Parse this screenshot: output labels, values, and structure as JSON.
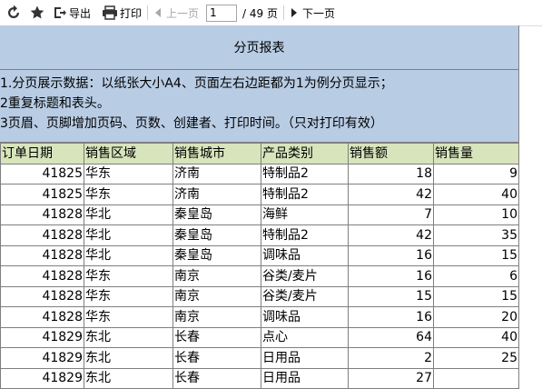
{
  "toolbar": {
    "export_label": "导出",
    "print_label": "打印",
    "prev_label": "上一页",
    "next_label": "下一页",
    "current_page": "1",
    "total_pages": "/ 49 页"
  },
  "report": {
    "title": "分页报表",
    "description": [
      "1.分页展示数据：以纸张大小A4、页面左右边距都为1为例分页显示；",
      "2重复标题和表头。",
      "3页眉、页脚增加页码、页数、创建者、打印时间。（只对打印有效）"
    ],
    "columns": [
      "订单日期",
      "销售区域",
      "销售城市",
      "产品类别",
      "销售额",
      "销售量"
    ],
    "rows": [
      [
        "41825",
        "华东",
        "济南",
        "特制品2",
        "18",
        "9"
      ],
      [
        "41825",
        "华东",
        "济南",
        "特制品2",
        "42",
        "40"
      ],
      [
        "41828",
        "华北",
        "秦皇岛",
        "海鲜",
        "7",
        "10"
      ],
      [
        "41828",
        "华北",
        "秦皇岛",
        "特制品2",
        "42",
        "35"
      ],
      [
        "41828",
        "华北",
        "秦皇岛",
        "调味品",
        "16",
        "15"
      ],
      [
        "41828",
        "华东",
        "南京",
        "谷类/麦片",
        "16",
        "6"
      ],
      [
        "41828",
        "华东",
        "南京",
        "谷类/麦片",
        "15",
        "15"
      ],
      [
        "41828",
        "华东",
        "南京",
        "调味品",
        "16",
        "20"
      ],
      [
        "41829",
        "东北",
        "长春",
        "点心",
        "64",
        "40"
      ],
      [
        "41829",
        "东北",
        "长春",
        "日用品",
        "2",
        "25"
      ],
      [
        "41829",
        "东北",
        "长春",
        "日用品",
        "27",
        ""
      ]
    ]
  },
  "colors": {
    "title_bg": "#b8cce4",
    "header_bg": "#d8e4bc",
    "grid": "#7f7f7f"
  }
}
